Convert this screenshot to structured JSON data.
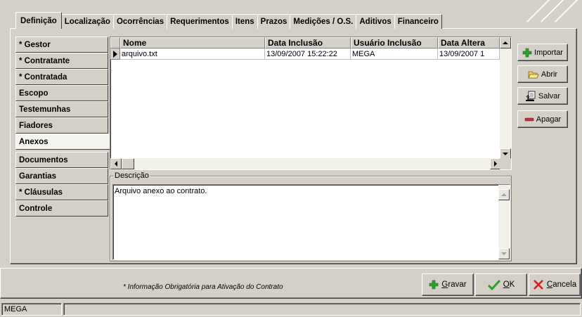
{
  "tabs": [
    {
      "label": "Definição",
      "active": true
    },
    {
      "label": "Localização",
      "active": false
    },
    {
      "label": "Ocorrências",
      "active": false
    },
    {
      "label": "Requerimentos",
      "active": false
    },
    {
      "label": "Itens",
      "active": false
    },
    {
      "label": "Prazos",
      "active": false
    },
    {
      "label": "Medições / O.S.",
      "active": false
    },
    {
      "label": "Aditivos",
      "active": false
    },
    {
      "label": "Financeiro",
      "active": false
    }
  ],
  "sidebar": {
    "items": [
      {
        "label": "* Gestor"
      },
      {
        "label": "* Contratante"
      },
      {
        "label": "* Contratada"
      },
      {
        "label": "Escopo"
      },
      {
        "label": "Testemunhas"
      },
      {
        "label": "Fiadores"
      },
      {
        "label": "Anexos",
        "active": true
      },
      {
        "label": "Documentos"
      },
      {
        "label": "Garantias"
      },
      {
        "label": "* Cláusulas"
      },
      {
        "label": "Controle"
      }
    ]
  },
  "grid": {
    "columns": [
      "Nome",
      "Data Inclusão",
      "Usuário Inclusão",
      "Data Altera"
    ],
    "rows": [
      [
        "arquivo.txt",
        "13/09/2007 15:22:22",
        "MEGA",
        "13/09/2007 1"
      ]
    ]
  },
  "description": {
    "legend": "Descrição",
    "text": "Arquivo anexo ao contrato."
  },
  "actions": {
    "importar": "Importar",
    "abrir": "Abrir",
    "salvar": "Salvar",
    "apagar": "Apagar"
  },
  "footer": {
    "note": "* Informação Obrigatória para Ativação do Contrato",
    "gravar_pre": "",
    "gravar_u": "G",
    "gravar_post": "ravar",
    "ok_u": "O",
    "ok_post": "K",
    "cancela_u": "C",
    "cancela_post": "ancela"
  },
  "statusbar": {
    "user": "MEGA"
  },
  "colors": {
    "face": "#d4d0c8",
    "import_green": "#2e9e2e",
    "ok_green": "#2ea02e",
    "cancel_red": "#d02020",
    "delete_red": "#c0303a"
  }
}
